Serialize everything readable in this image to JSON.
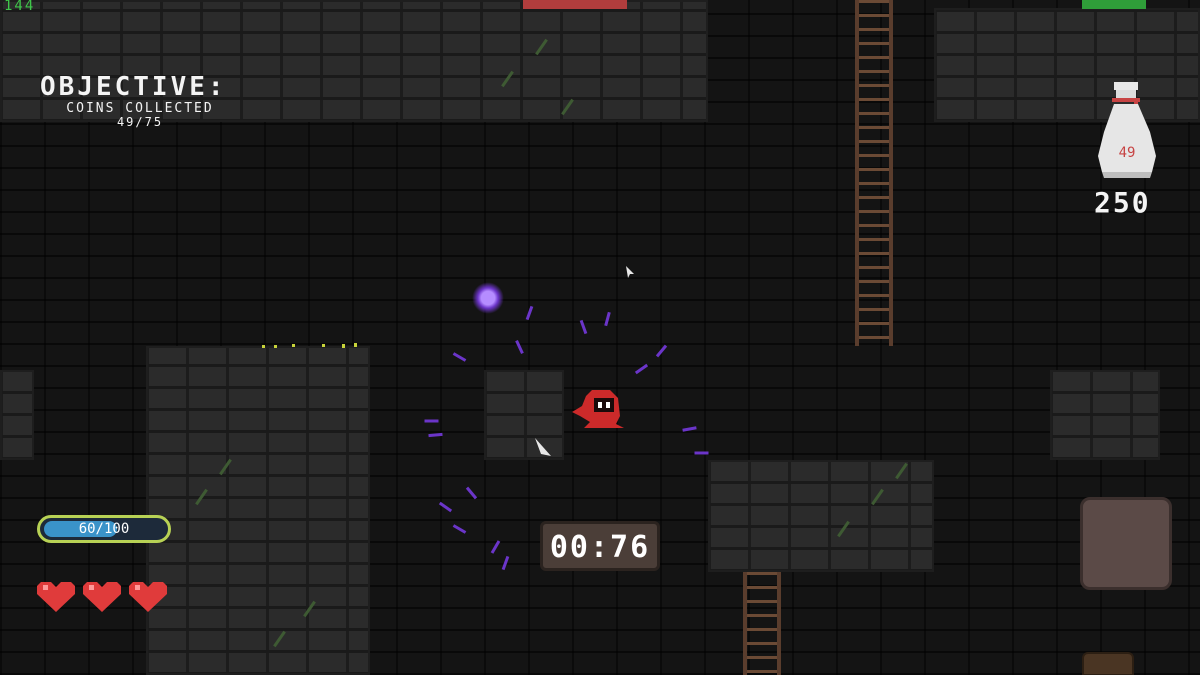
{
  "hud": {
    "fps_counter": "144",
    "objective": {
      "title": "OBJECTIVE:",
      "line": "COINS COLLECTED",
      "progress": "49/75"
    },
    "coin_bag": {
      "count": "49",
      "icon": "coin-bag-icon"
    },
    "coin_total": "250",
    "mana_bar": {
      "label": "60/100",
      "value": 60,
      "max": 100,
      "color": "#3a93c9",
      "border_color": "#b8d255"
    },
    "hearts": {
      "count": 3,
      "icon": "heart-icon",
      "color": "#e03b3b"
    },
    "timer": "00:76",
    "top_bars": {
      "left_color": "#b13d3d",
      "right_color": "#2f9e39"
    }
  },
  "scene": {
    "player": {
      "icon": "red-hooded-player-icon",
      "color": "#cc2a2a"
    },
    "magic_orb": {
      "icon": "purple-orb-icon",
      "color": "#6b35c9"
    },
    "action_button": {
      "icon": "action-button"
    }
  }
}
